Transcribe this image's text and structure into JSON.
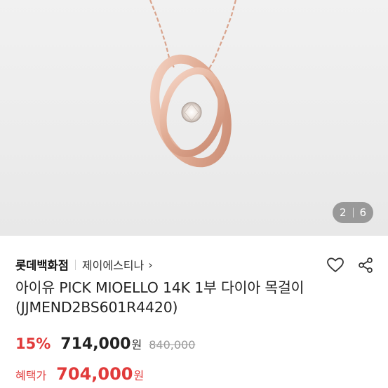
{
  "product_image": {
    "alt": "",
    "pager": {
      "current": "2",
      "total": "6"
    }
  },
  "store": {
    "name": "롯데백화점",
    "brand": "제이에스티나",
    "chevron": "›"
  },
  "actions": {
    "wishlist_icon": "heart-icon",
    "share_icon": "share-icon"
  },
  "product": {
    "title": "아이유 PICK MIOELLO 14K 1부 다이아 목걸이 (JJMEND2BS601R4420)"
  },
  "pricing": {
    "discount": "15%",
    "price": "714,000",
    "price_unit": "원",
    "original_price": "840,000",
    "benefit_label": "혜택가",
    "benefit_price": "704,000",
    "benefit_unit": "원"
  },
  "colors": {
    "accent_red": "#e13a3a",
    "rose_gold": "#e6b9a4"
  }
}
